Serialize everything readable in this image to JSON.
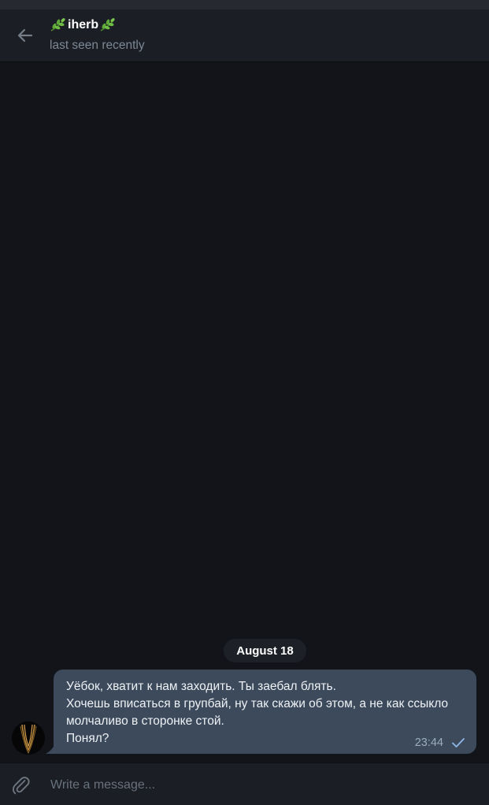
{
  "header": {
    "title": "iherb",
    "title_emoji": "herb",
    "status": "last seen recently"
  },
  "chat": {
    "date_separator": "August 18",
    "messages": [
      {
        "direction": "outgoing",
        "text": "Уёбок, хватит к нам заходить. Ты заебал блять.\nХочешь вписаться в групбай, ну так скажи об этом, а не как ссыкло молчаливо в сторонке стой.\nПонял?",
        "time": "23:44",
        "read_state": "sent-single-check"
      }
    ]
  },
  "composer": {
    "placeholder": "Write a message..."
  },
  "colors": {
    "background": "#121419",
    "header": "#1b1e24",
    "bubble": "#3c4a5c",
    "accent": "#8fb8e8",
    "leaf": "#5fa83a"
  }
}
